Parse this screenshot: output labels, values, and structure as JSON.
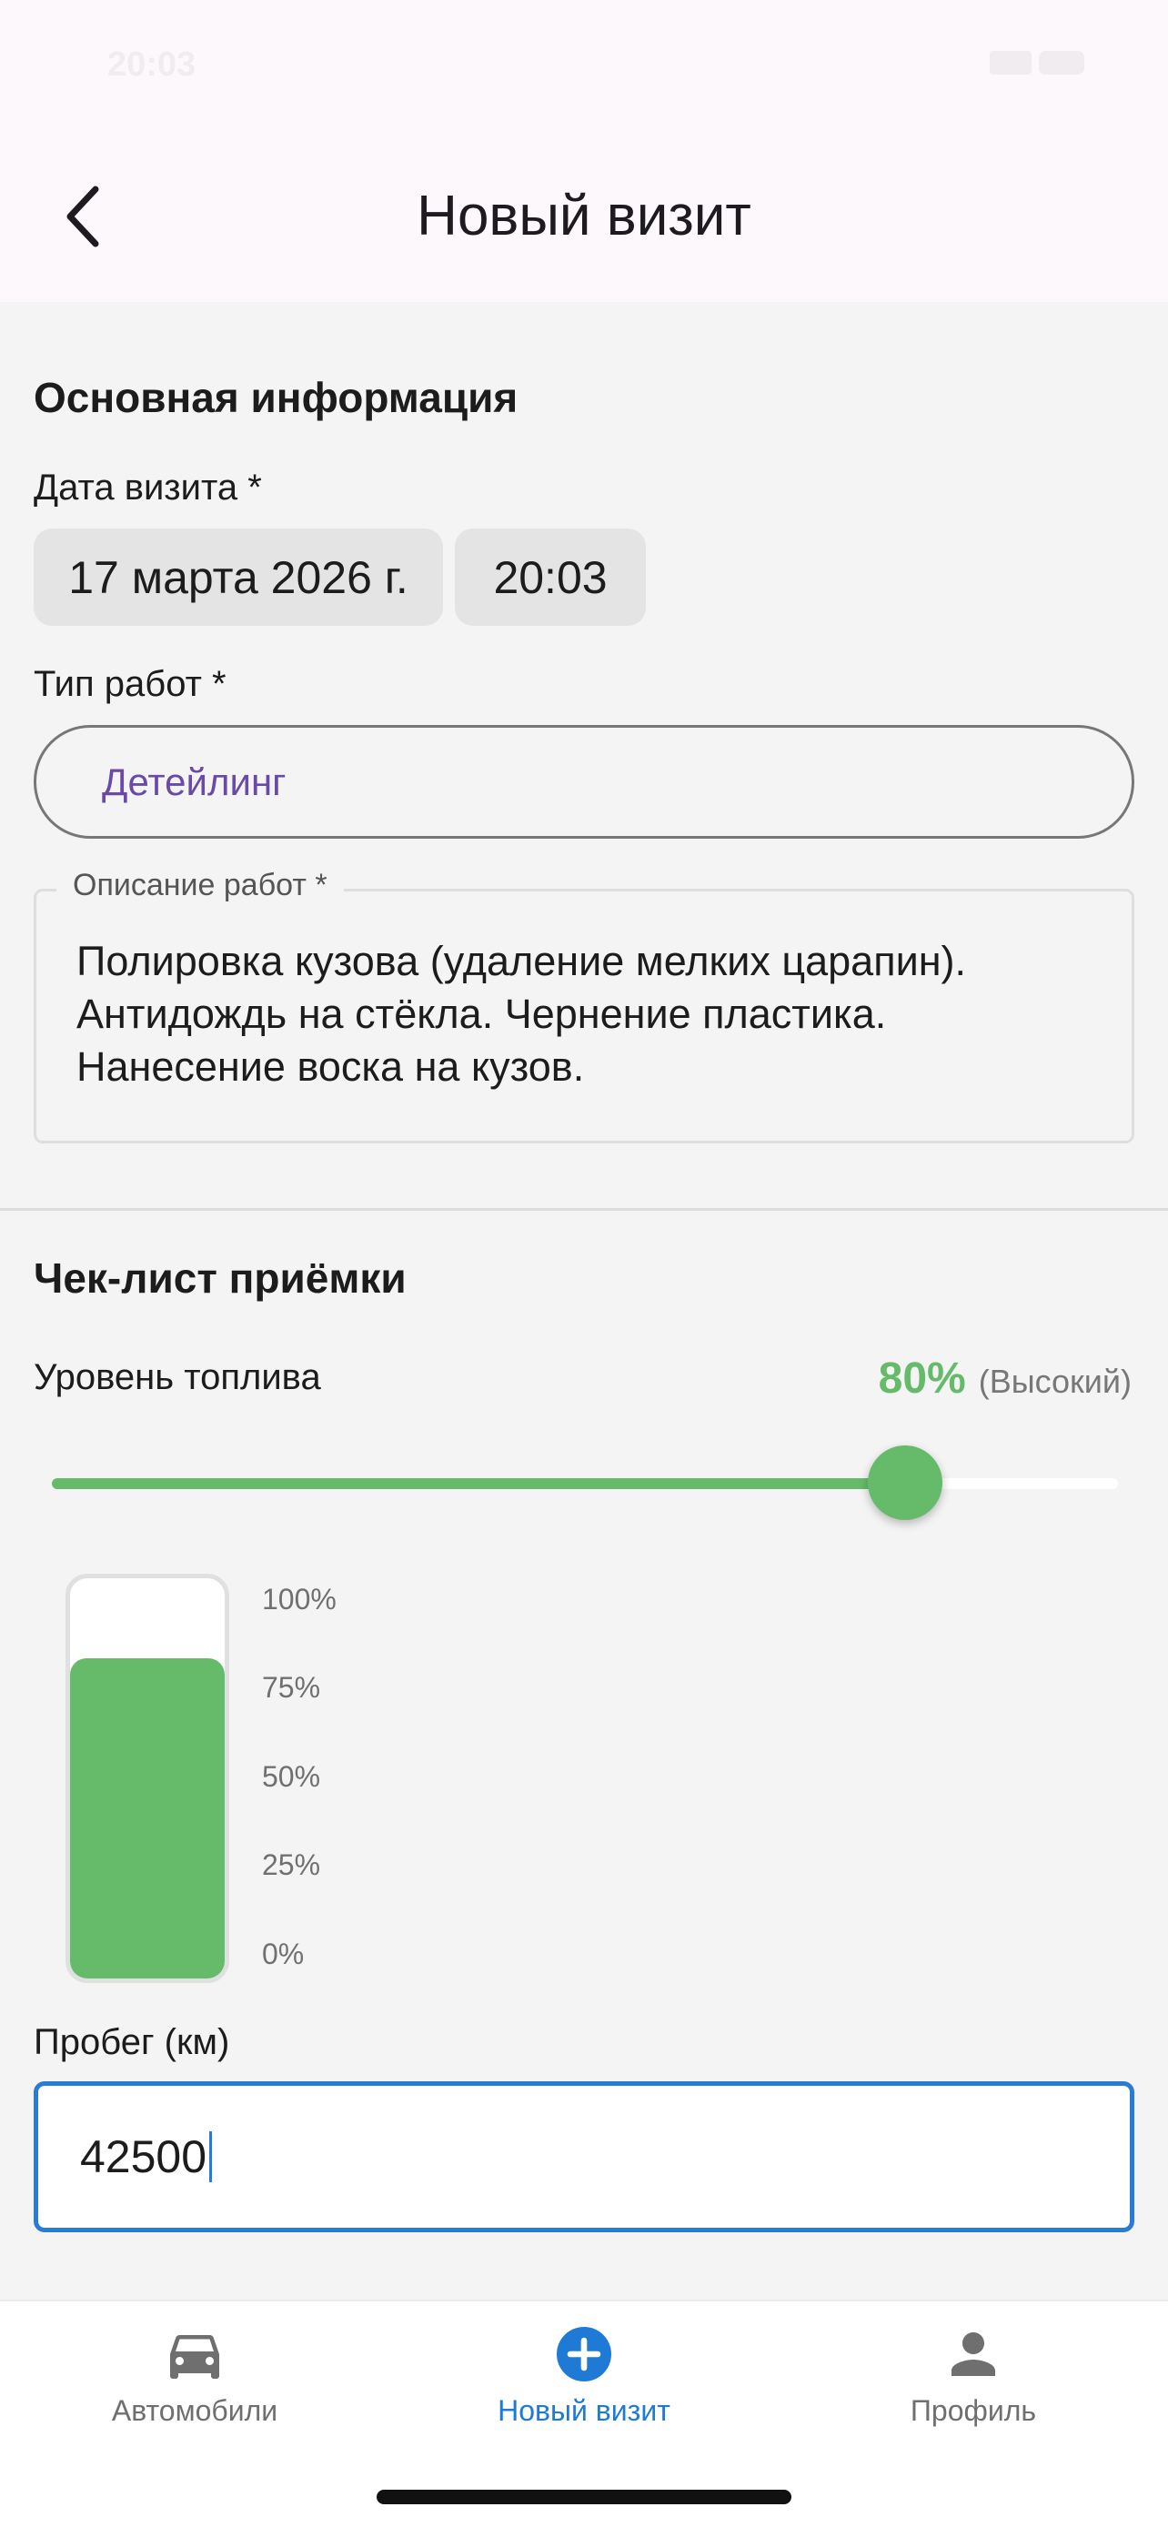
{
  "status_bar": {
    "time": "20:03"
  },
  "header": {
    "title": "Новый визит",
    "back_icon": "chevron-left-icon"
  },
  "basic_info": {
    "section_title": "Основная информация",
    "date_label": "Дата визита *",
    "date_value": "17 марта 2026 г.",
    "time_value": "20:03",
    "work_type_label": "Тип работ *",
    "work_type_value": "Детейлинг",
    "description_label": "Описание работ *",
    "description_lines": [
      "Полировка кузова (удаление мелких царапин).",
      "Антидождь на стёкла. Чернение пластика.",
      "Нанесение воска на кузов."
    ]
  },
  "checklist": {
    "section_title": "Чек-лист приёмки",
    "fuel_label": "Уровень топлива",
    "fuel_percent_text": "80%",
    "fuel_level_text": "(Высокий)",
    "fuel_level": 0.8,
    "gauge_ticks": [
      "100%",
      "75%",
      "50%",
      "25%",
      "0%"
    ],
    "mileage_label": "Пробег (км)",
    "mileage_value": "42500"
  },
  "tab_bar": {
    "items": [
      {
        "label": "Автомобили",
        "icon": "car-icon",
        "active": false
      },
      {
        "label": "Новый визит",
        "icon": "add-circle-icon",
        "active": true
      },
      {
        "label": "Профиль",
        "icon": "person-icon",
        "active": false
      }
    ]
  },
  "colors": {
    "accent_green": "#66bb6a",
    "accent_blue": "#1f7ad6",
    "work_type_text": "#6a4aa8",
    "header_bg": "#fdf8fc",
    "page_bg": "#f4f4f4"
  }
}
